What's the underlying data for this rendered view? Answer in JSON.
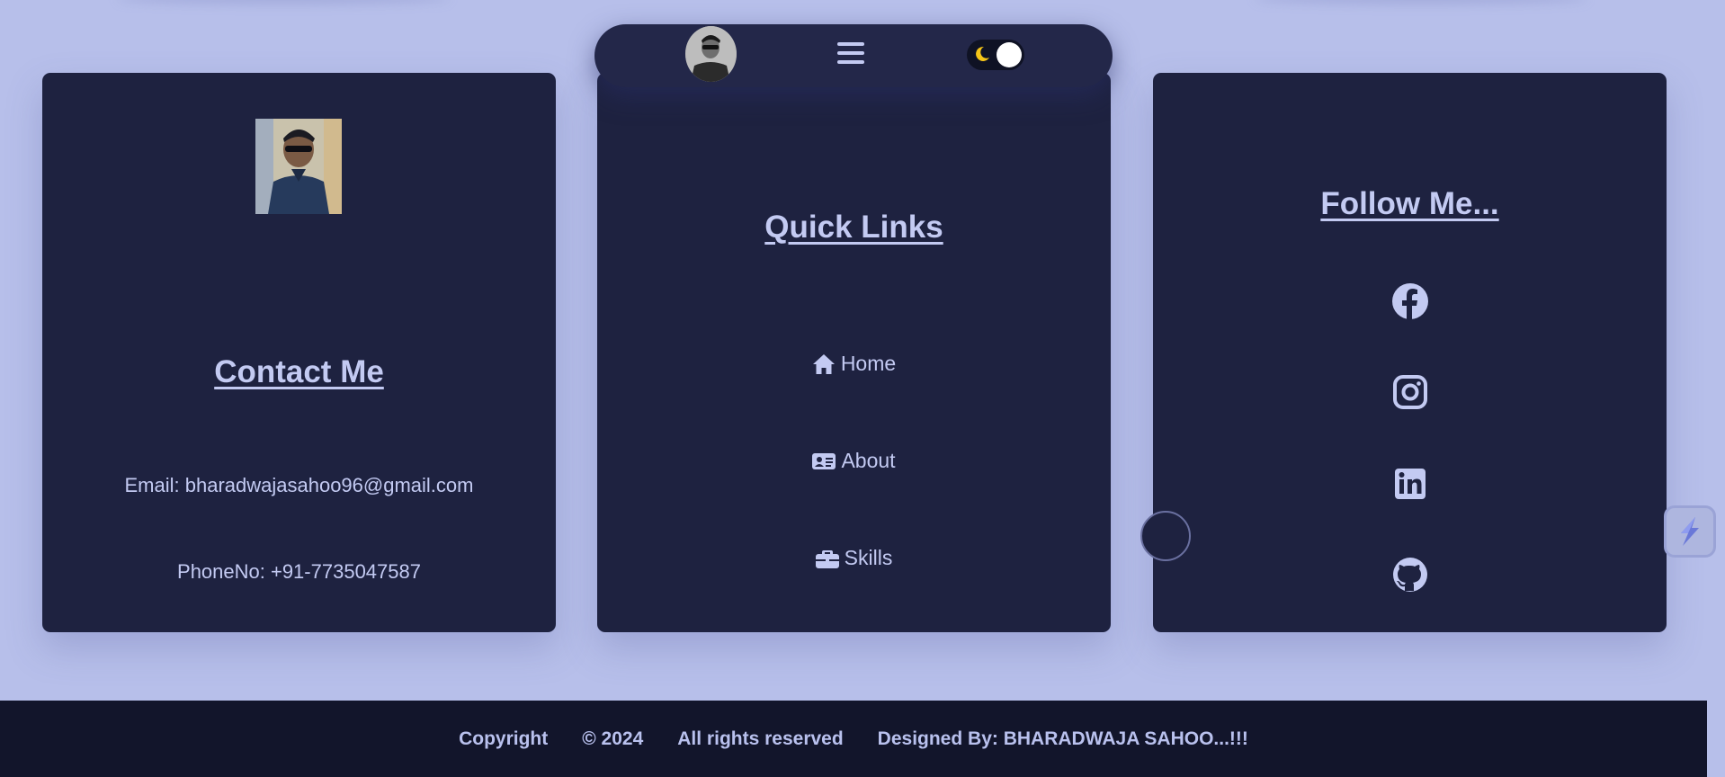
{
  "contact": {
    "title": "Contact Me",
    "email": "Email: bharadwajasahoo96@gmail.com",
    "phone": "PhoneNo: +91-7735047587",
    "photo_icon": "profile-photo"
  },
  "quick_links": {
    "title": "Quick Links",
    "items": [
      {
        "label": "Home",
        "icon": "home-icon"
      },
      {
        "label": "About",
        "icon": "id-card-icon"
      },
      {
        "label": "Skills",
        "icon": "briefcase-icon"
      }
    ]
  },
  "follow": {
    "title": "Follow Me...",
    "socials": [
      "facebook-icon",
      "instagram-icon",
      "linkedin-icon",
      "github-icon"
    ]
  },
  "navbar": {
    "avatar_icon": "avatar",
    "menu_icon": "hamburger-menu-icon",
    "toggle_icon": "moon-icon"
  },
  "footer": {
    "copyright": "Copyright",
    "year": "© 2024",
    "rights": "All rights reserved",
    "designer": "Designed By: BHARADWAJA SAHOO...!!!"
  },
  "colors": {
    "page_bg": "#b7bfea",
    "card_bg": "#1e2240",
    "text": "#c3caf2",
    "footer_bg": "#12152b",
    "moon": "#f5c518"
  }
}
